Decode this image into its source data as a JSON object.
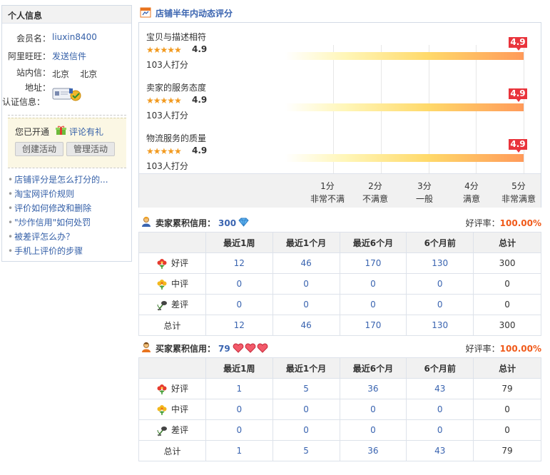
{
  "sidebar": {
    "title": "个人信息",
    "member_label": "会员名：",
    "member_value": "liuxin8400",
    "wangwang_label": "阿里旺旺：",
    "wangwang_value": "发送信件",
    "station_label": "站内信：",
    "station_value": "北京    北京",
    "address_label": "地址：",
    "cert_label": "认证信息：",
    "activity_text": "您已开通",
    "activity_link": "评论有礼",
    "create_btn": "创建活动",
    "manage_btn": "管理活动",
    "questions": [
      "店铺评分是怎么打分的...",
      "淘宝网评价规则",
      "评价如何修改和删除",
      "\"炒作信用\"如何处罚",
      "被差评怎么办？",
      "手机上评价的步骤"
    ]
  },
  "dynamic": {
    "title": "店铺半年内动态评分",
    "metrics": [
      {
        "name": "宝贝与描述相符",
        "stars": "★★★★★",
        "score": "4.9",
        "count": "103人打分",
        "flag": "4.9"
      },
      {
        "name": "卖家的服务态度",
        "stars": "★★★★★",
        "score": "4.9",
        "count": "103人打分",
        "flag": "4.9"
      },
      {
        "name": "物流服务的质量",
        "stars": "★★★★★",
        "score": "4.9",
        "count": "103人打分",
        "flag": "4.9"
      }
    ],
    "scale": [
      {
        "pts": "1分",
        "desc": "非常不满"
      },
      {
        "pts": "2分",
        "desc": "不满意"
      },
      {
        "pts": "3分",
        "desc": "一般"
      },
      {
        "pts": "4分",
        "desc": "满意"
      },
      {
        "pts": "5分",
        "desc": "非常满意"
      }
    ]
  },
  "seller": {
    "label": "卖家累积信用：",
    "credit": "300",
    "rate_label": "好评率：",
    "rate": "100.00%",
    "headers": [
      "",
      "最近1周",
      "最近1个月",
      "最近6个月",
      "6个月前",
      "总计"
    ],
    "rows": [
      {
        "kind": "好评",
        "vals": [
          "12",
          "46",
          "170",
          "130"
        ],
        "total": "300"
      },
      {
        "kind": "中评",
        "vals": [
          "0",
          "0",
          "0",
          "0"
        ],
        "total": "0"
      },
      {
        "kind": "差评",
        "vals": [
          "0",
          "0",
          "0",
          "0"
        ],
        "total": "0"
      },
      {
        "kind": "总计",
        "vals": [
          "12",
          "46",
          "170",
          "130"
        ],
        "total": "300"
      }
    ]
  },
  "buyer": {
    "label": "买家累积信用：",
    "credit": "79",
    "rate_label": "好评率：",
    "rate": "100.00%",
    "headers": [
      "",
      "最近1周",
      "最近1个月",
      "最近6个月",
      "6个月前",
      "总计"
    ],
    "rows": [
      {
        "kind": "好评",
        "vals": [
          "1",
          "5",
          "36",
          "43"
        ],
        "total": "79"
      },
      {
        "kind": "中评",
        "vals": [
          "0",
          "0",
          "0",
          "0"
        ],
        "total": "0"
      },
      {
        "kind": "差评",
        "vals": [
          "0",
          "0",
          "0",
          "0"
        ],
        "total": "0"
      },
      {
        "kind": "总计",
        "vals": [
          "1",
          "5",
          "36",
          "43"
        ],
        "total": "79"
      }
    ]
  }
}
